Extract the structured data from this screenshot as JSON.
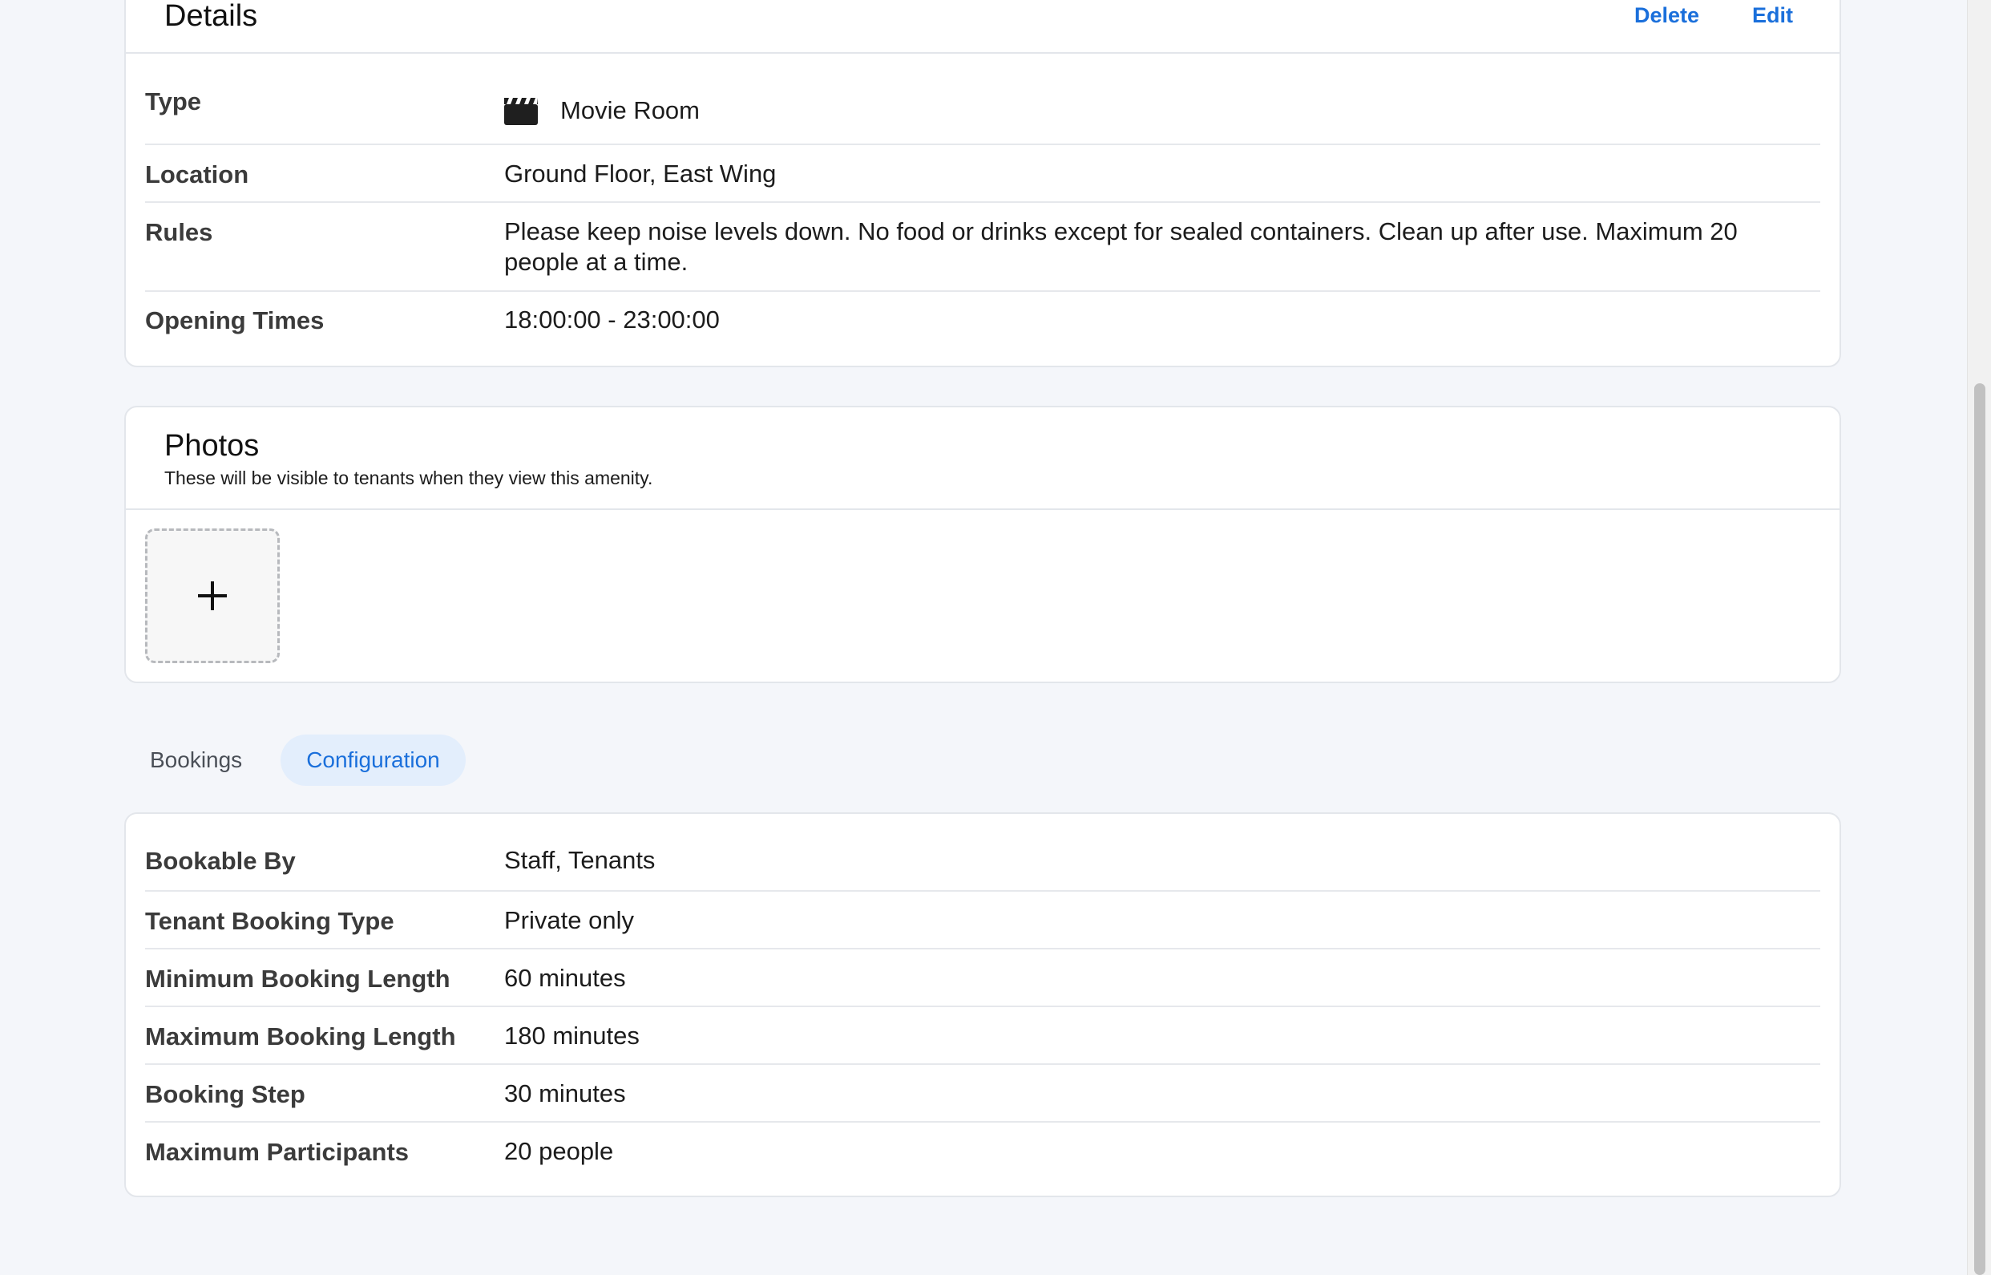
{
  "details": {
    "title": "Details",
    "delete_label": "Delete",
    "edit_label": "Edit",
    "rows": {
      "type": {
        "label": "Type",
        "value": "Movie Room",
        "icon": "clapperboard-icon"
      },
      "location": {
        "label": "Location",
        "value": "Ground Floor, East Wing"
      },
      "rules": {
        "label": "Rules",
        "value": "Please keep noise levels down. No food or drinks except for sealed containers. Clean up after use. Maximum 20 people at a time."
      },
      "opening_times": {
        "label": "Opening Times",
        "value": "18:00:00 - 23:00:00"
      }
    }
  },
  "photos": {
    "title": "Photos",
    "subtitle": "These will be visible to tenants when they view this amenity.",
    "add_icon": "plus-icon"
  },
  "tabs": {
    "bookings": "Bookings",
    "configuration": "Configuration",
    "active": "Configuration"
  },
  "configuration": {
    "rows": [
      {
        "label": "Bookable By",
        "value": "Staff, Tenants"
      },
      {
        "label": "Tenant Booking Type",
        "value": "Private only"
      },
      {
        "label": "Minimum Booking Length",
        "value": "60 minutes"
      },
      {
        "label": "Maximum Booking Length",
        "value": "180 minutes"
      },
      {
        "label": "Booking Step",
        "value": "30 minutes"
      },
      {
        "label": "Maximum Participants",
        "value": "20 people"
      }
    ]
  },
  "colors": {
    "accent": "#1a6fdb",
    "background": "#f4f6fa",
    "tab_active_bg": "#e3eefc"
  }
}
